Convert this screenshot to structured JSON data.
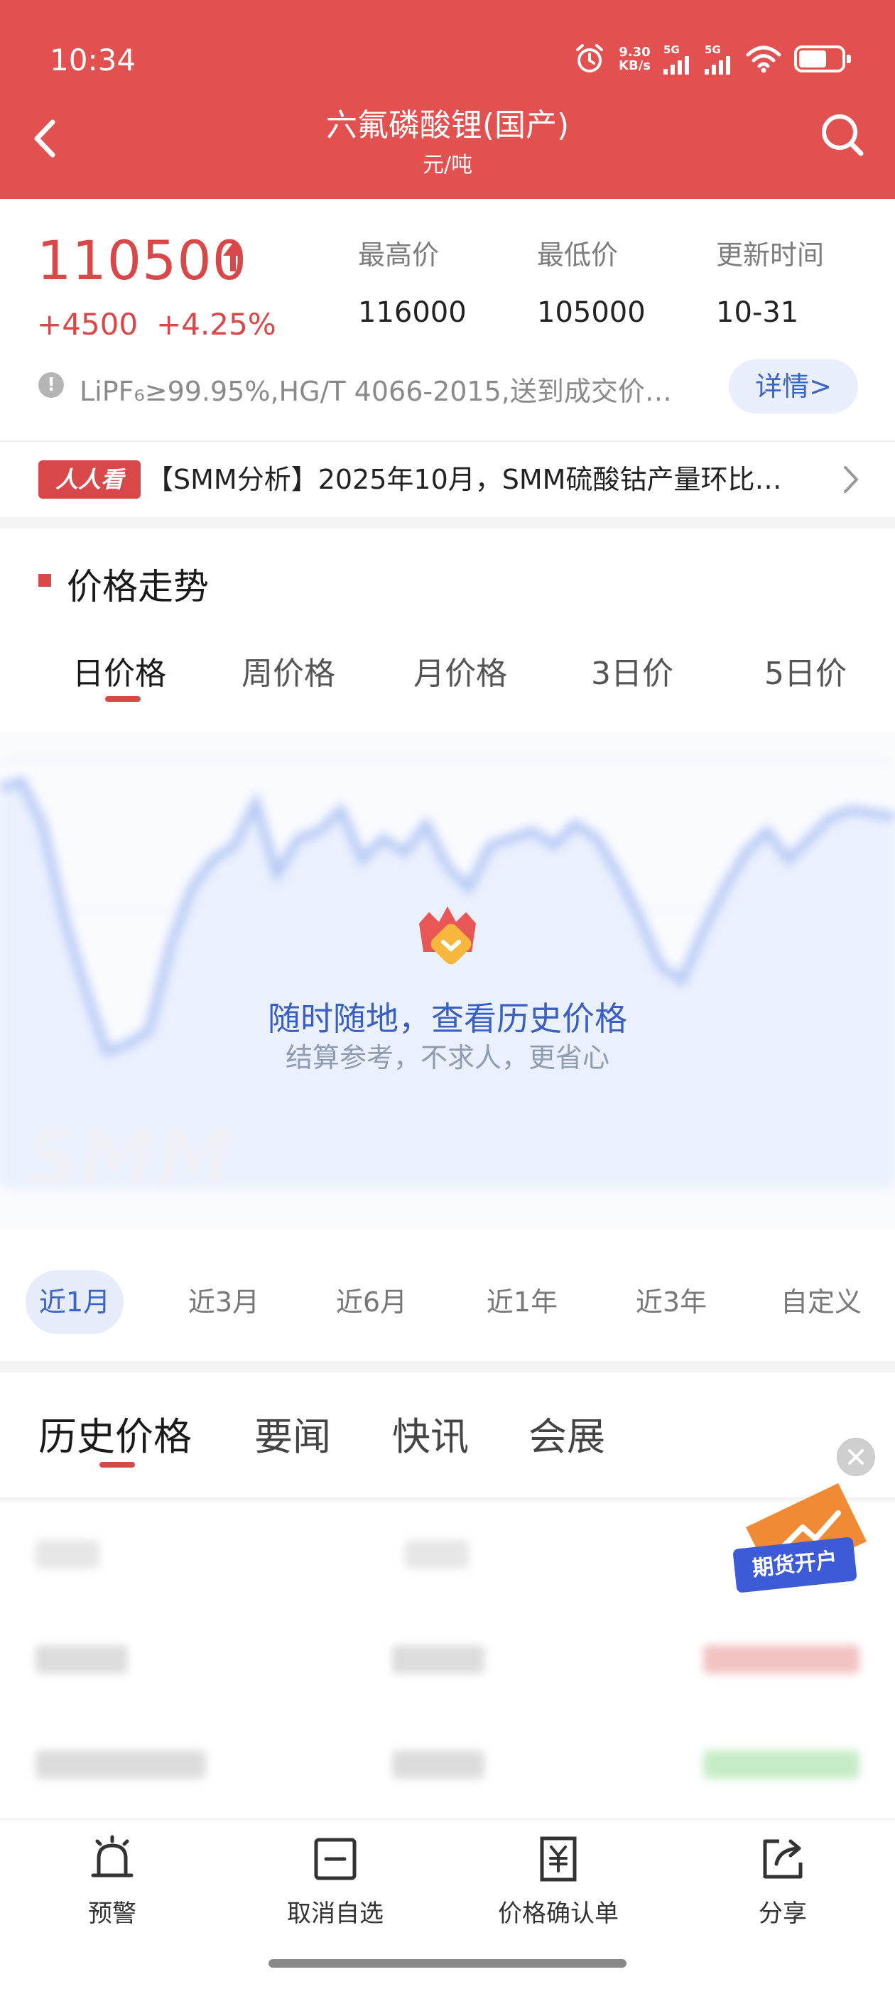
{
  "status_bar": {
    "time": "10:34",
    "net_speed_value": "9.30",
    "net_speed_unit": "KB/s",
    "signal_1": "5G",
    "signal_2": "5G",
    "icons": [
      "alarm-icon",
      "signal-icon",
      "signal-icon",
      "wifi-icon",
      "battery-icon"
    ]
  },
  "header": {
    "title": "六氟磷酸锂(国产)",
    "unit": "元/吨",
    "icons": [
      "back-arrow-icon",
      "search-icon"
    ]
  },
  "price": {
    "current": "110500",
    "change": "+4500",
    "change_pct": "+4.25%",
    "trend_icon": "arrow-up-icon",
    "color_up": "#d94848"
  },
  "stats": [
    {
      "label": "最高价",
      "value": "116000"
    },
    {
      "label": "最低价",
      "value": "105000"
    },
    {
      "label": "更新时间",
      "value": "10-31"
    }
  ],
  "spec": {
    "text": "LiPF₆≥99.95%,HG/T 4066-2015,送到成交价…",
    "detail_label": "详情>"
  },
  "news": {
    "badge": "人人看",
    "headline": "【SMM分析】2025年10月，SMM硫酸钴产量环比…"
  },
  "trend": {
    "section_title": "价格走势",
    "tabs": [
      "日价格",
      "周价格",
      "月价格",
      "3日价",
      "5日价"
    ],
    "active_tab": 0,
    "watermark": "SMM",
    "lock_title": "随时随地，查看历史价格",
    "lock_subtitle": "结算参考，不求人，更省心",
    "range_tabs": [
      "近1月",
      "近3月",
      "近6月",
      "近1年",
      "近3年",
      "自定义"
    ],
    "active_range": 0,
    "accent": "#3b63c6"
  },
  "lower_tabs": {
    "tabs": [
      "历史价格",
      "要闻",
      "快讯",
      "会展"
    ],
    "active": 0
  },
  "ad": {
    "label": "期货开户"
  },
  "bottom_nav": [
    {
      "label": "预警",
      "icon": "alarm-bell-icon"
    },
    {
      "label": "取消自选",
      "icon": "remove-watchlist-icon"
    },
    {
      "label": "价格确认单",
      "icon": "price-confirm-icon"
    },
    {
      "label": "分享",
      "icon": "share-icon"
    }
  ]
}
